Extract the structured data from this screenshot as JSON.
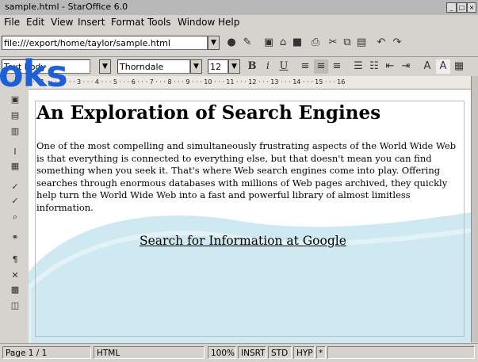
{
  "window": {
    "title": "sample.html - StarOffice 6.0"
  },
  "menu": [
    "File",
    "Edit",
    "View",
    "Insert",
    "Format",
    "Tools",
    "Window",
    "Help"
  ],
  "urlbar": {
    "url": "file:///export/home/taylor/sample.html"
  },
  "formatbar": {
    "style": "Text body",
    "font": "Thorndale",
    "size": "12"
  },
  "ruler": {
    "marks": "· · · 1 · · · 2 · · · 3 · · · 4 · · · 5 · · · 6 · · · 7 · · · 8 · · · 9 · · · 10 · · · 11 · · · 12 · · · 13 · · · 14 · · · 15 · · · 16"
  },
  "document": {
    "heading": "An Exploration of Search Engines",
    "paragraph": "One of the most compelling and simultaneously frustrating aspects of the World Wide Web is that everything is connected to everything else, but that doesn't mean you can find something when you seek it. That's where Web search engines come into play. Offering searches through enormous databases with millions of Web pages archived, they quickly help turn the World Wide Web into a fast and powerful library of almost limitless information.",
    "link": "Search for Information at Google"
  },
  "overlay_text": "oks",
  "status": {
    "page": "Page 1 / 1",
    "mode": "HTML",
    "zoom": "100%",
    "insert": "INSRT",
    "std": "STD",
    "hyp": "HYP",
    "star": "*"
  },
  "colors": {
    "overlay": "#1e5fd8",
    "swoosh": "#cfe9f2",
    "chrome": "#d6d3ce"
  }
}
